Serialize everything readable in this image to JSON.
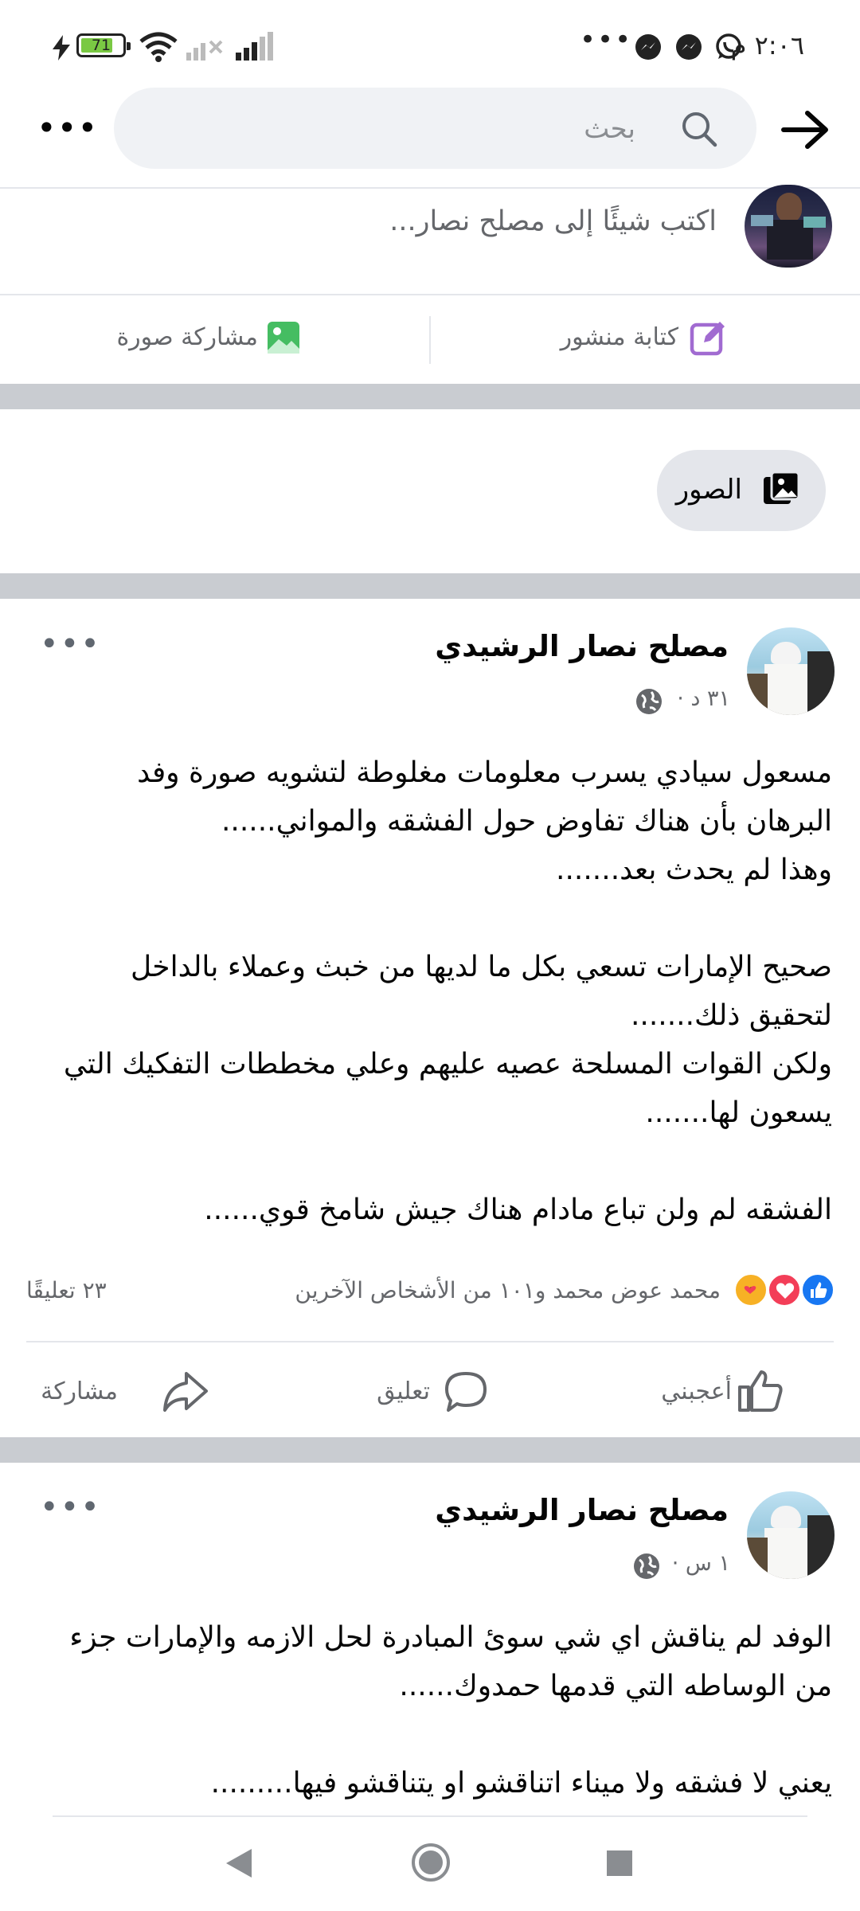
{
  "status_bar": {
    "time": "٢:٠٦ م",
    "battery": "71"
  },
  "header": {
    "search_placeholder": "بحث"
  },
  "composer": {
    "placeholder": "اكتب شيئًا إلى مصلح نصار...",
    "write_post": "كتابة منشور",
    "share_photo": "مشاركة صورة"
  },
  "photos_chip": "الصور",
  "posts": [
    {
      "author": "مصلح نصار الرشيدي",
      "time": "٣١ د ·",
      "body": "مسعول سيادي يسرب معلومات مغلوطة لتشويه صورة وفد\nالبرهان بأن هناك تفاوض حول الفشقه والمواني......\nوهذا لم يحدث بعد.......\n\nصحيح الإمارات تسعي بكل ما لديها من خبث وعملاء بالداخل\nلتحقيق ذلك.......\nولكن القوات المسلحة عصيه عليهم وعلي مخططات التفكيك التي\nيسعون لها.......\n\nالفشقه لم ولن تباع مادام هناك جيش شامخ قوي......",
      "reactions": "محمد عوض محمد و١٠١ من الأشخاص الآخرين",
      "comments": "٢٣ تعليقًا",
      "like": "أعجبني",
      "comment": "تعليق",
      "share": "مشاركة"
    },
    {
      "author": "مصلح نصار الرشيدي",
      "time": "١ س ·",
      "body": "الوفد لم يناقش اي شي سوئ المبادرة لحل الازمه والإمارات جزء\nمن الوساطه التي قدمها حمدوك......\n\nيعني لا فشقه ولا ميناء اتناقشو او يتناقشو فيها........."
    }
  ],
  "colors": {
    "facebook_blue": "#1877f2",
    "green": "#45bd62",
    "purple": "#a16bd1",
    "divider": "#c9ccd1",
    "secondary_text": "#65676b"
  }
}
